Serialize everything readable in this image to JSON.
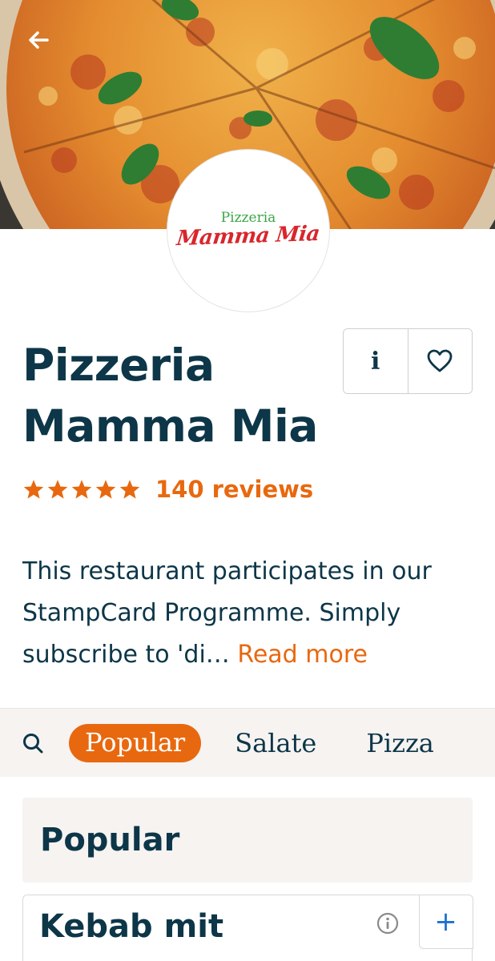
{
  "header": {
    "back_icon": "arrow-left-icon",
    "hero_image": "pizza-margherita-photo"
  },
  "restaurant": {
    "logo_top": "Pizzeria",
    "logo_bottom": "Mamma Mia",
    "name": "Pizzeria Mamma Mia",
    "rating_stars": 5,
    "reviews_label": "140 reviews",
    "description": "This restaurant participates in our StampCard Programme. Simply subscribe to 'di…",
    "read_more": "Read more"
  },
  "actions": {
    "info_label": "i",
    "favorite_icon": "heart-icon"
  },
  "tabs": {
    "search_icon": "search-icon",
    "items": [
      {
        "label": "Popular",
        "active": true
      },
      {
        "label": "Salate",
        "active": false
      },
      {
        "label": "Pizza",
        "active": false
      }
    ]
  },
  "menu": {
    "section_title": "Popular",
    "items": [
      {
        "name": "Kebab mit",
        "info_icon": "info-icon",
        "add_label": "+"
      }
    ]
  },
  "colors": {
    "primary_text": "#0d3648",
    "accent": "#e8680f",
    "tab_background": "#f6f3f1",
    "logo_green": "#3aa647",
    "logo_red": "#d8262c",
    "add_button": "#1f6fd1"
  }
}
